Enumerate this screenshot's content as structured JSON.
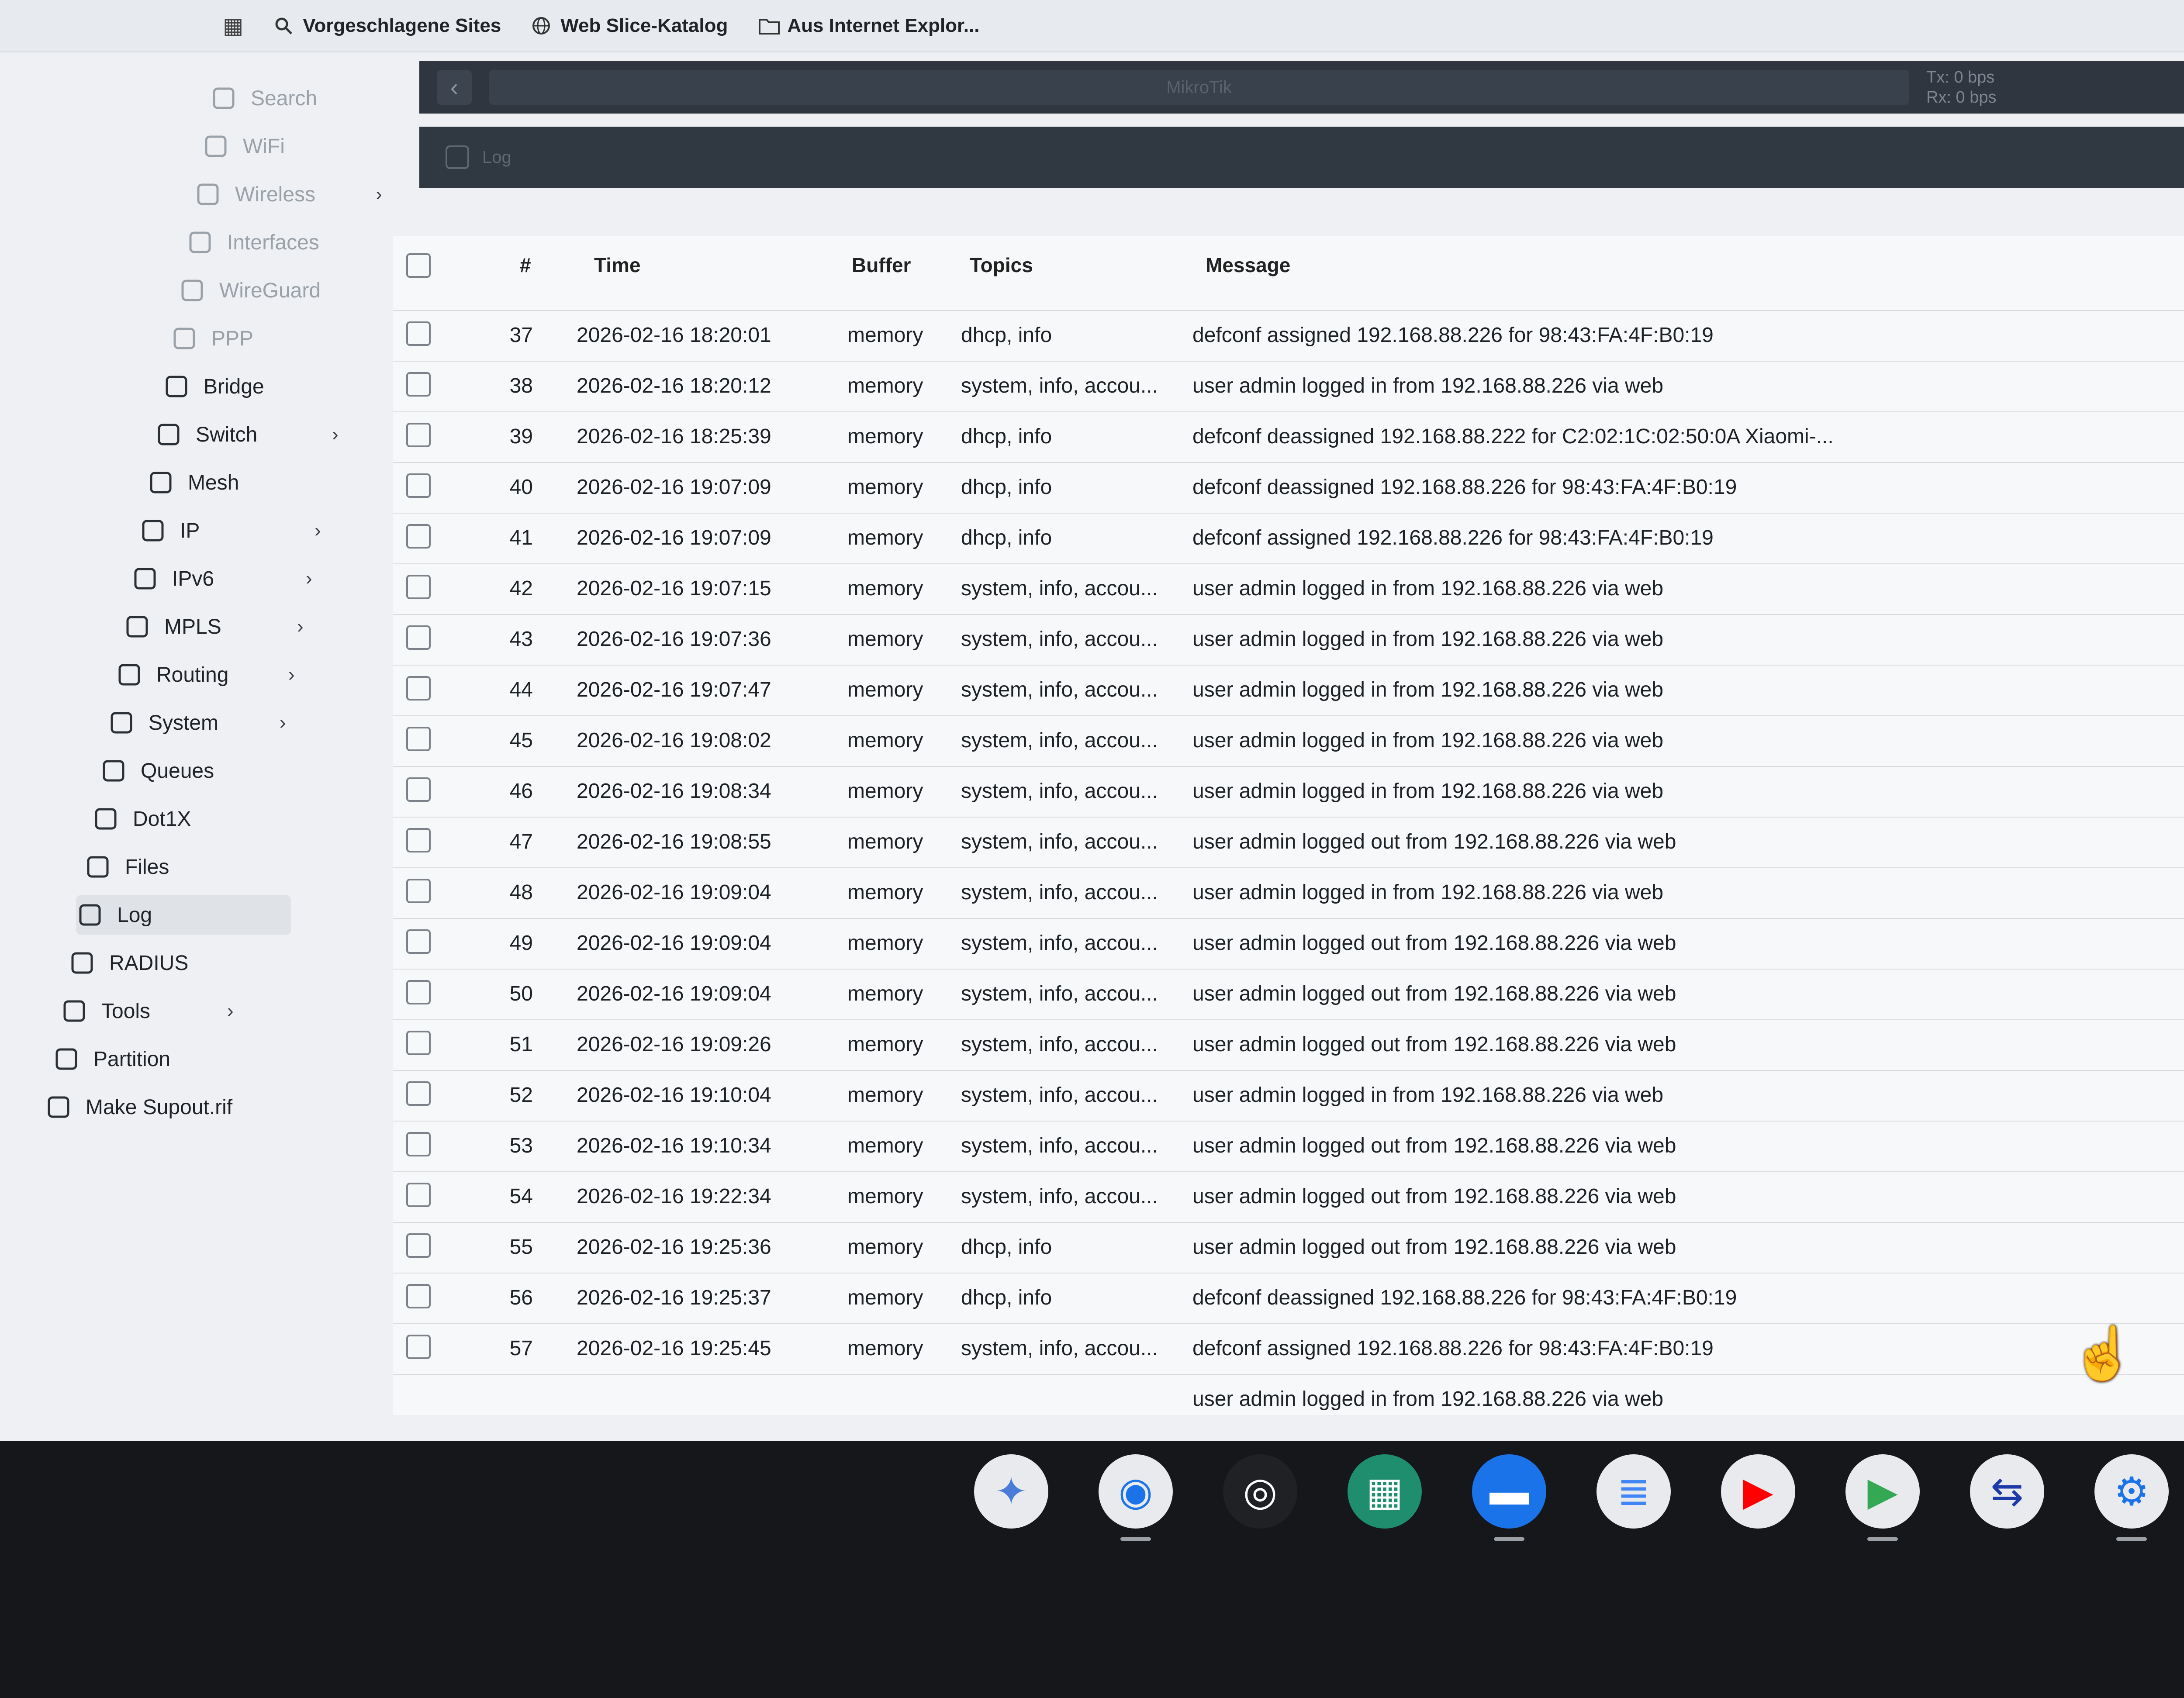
{
  "favorites": {
    "items": [
      {
        "label": "Vorgeschlagene Sites",
        "icon": "search-icon"
      },
      {
        "label": "Web Slice-Katalog",
        "icon": "globe-icon"
      },
      {
        "label": "Aus Internet Explor...",
        "icon": "folder-icon"
      }
    ]
  },
  "toolbar": {
    "identity": "MikroTik",
    "traffic_tx": "Tx: 0 bps",
    "traffic_rx": "Rx: 0 bps",
    "subbar_label": "Log"
  },
  "sidebar": {
    "items": [
      {
        "label": "Search",
        "icon": "search-icon"
      },
      {
        "label": "WiFi",
        "icon": "wifi-icon"
      },
      {
        "label": "Wireless",
        "icon": "antenna-icon",
        "chevron": true
      },
      {
        "label": "Interfaces",
        "icon": "interfaces-icon"
      },
      {
        "label": "WireGuard",
        "icon": "wireguard-icon"
      },
      {
        "label": "PPP",
        "icon": "ppp-icon"
      },
      {
        "label": "Bridge",
        "icon": "bridge-icon"
      },
      {
        "label": "Switch",
        "icon": "switch-icon",
        "chevron": true
      },
      {
        "label": "Mesh",
        "icon": "mesh-icon"
      },
      {
        "label": "IP",
        "icon": "ipv4-icon",
        "chevron": true
      },
      {
        "label": "IPv6",
        "icon": "ipv6-icon",
        "chevron": true
      },
      {
        "label": "MPLS",
        "icon": "mpls-icon",
        "chevron": true
      },
      {
        "label": "Routing",
        "icon": "routing-icon",
        "chevron": true
      },
      {
        "label": "System",
        "icon": "gear-icon",
        "chevron": true
      },
      {
        "label": "Queues",
        "icon": "queues-icon"
      },
      {
        "label": "Dot1X",
        "icon": "dot1x-icon"
      },
      {
        "label": "Files",
        "icon": "folder-icon"
      },
      {
        "label": "Log",
        "icon": "log-icon"
      },
      {
        "label": "RADIUS",
        "icon": "radius-icon"
      },
      {
        "label": "Tools",
        "icon": "tools-icon",
        "chevron": true
      },
      {
        "label": "Partition",
        "icon": "partition-icon"
      },
      {
        "label": "Make Supout.rif",
        "icon": "supout-icon"
      }
    ]
  },
  "table": {
    "headers": {
      "num": "#",
      "time": "Time",
      "buffer": "Buffer",
      "topics": "Topics",
      "message": "Message"
    },
    "rows": [
      {
        "num": "37",
        "time": "2026-02-16 18:20:01",
        "buffer": "memory",
        "topics": "dhcp, info",
        "message": "defconf assigned 192.168.88.226 for 98:43:FA:4F:B0:19"
      },
      {
        "num": "38",
        "time": "2026-02-16 18:20:12",
        "buffer": "memory",
        "topics": "system, info, accou...",
        "message": "user admin logged in from 192.168.88.226 via web"
      },
      {
        "num": "39",
        "time": "2026-02-16 18:25:39",
        "buffer": "memory",
        "topics": "dhcp, info",
        "message": "defconf deassigned 192.168.88.222 for C2:02:1C:02:50:0A Xiaomi-..."
      },
      {
        "num": "40",
        "time": "2026-02-16 19:07:09",
        "buffer": "memory",
        "topics": "dhcp, info",
        "message": "defconf deassigned 192.168.88.226 for 98:43:FA:4F:B0:19"
      },
      {
        "num": "41",
        "time": "2026-02-16 19:07:09",
        "buffer": "memory",
        "topics": "dhcp, info",
        "message": "defconf assigned 192.168.88.226 for 98:43:FA:4F:B0:19"
      },
      {
        "num": "42",
        "time": "2026-02-16 19:07:15",
        "buffer": "memory",
        "topics": "system, info, accou...",
        "message": "user admin logged in from 192.168.88.226 via web"
      },
      {
        "num": "43",
        "time": "2026-02-16 19:07:36",
        "buffer": "memory",
        "topics": "system, info, accou...",
        "message": "user admin logged in from 192.168.88.226 via web"
      },
      {
        "num": "44",
        "time": "2026-02-16 19:07:47",
        "buffer": "memory",
        "topics": "system, info, accou...",
        "message": "user admin logged in from 192.168.88.226 via web"
      },
      {
        "num": "45",
        "time": "2026-02-16 19:08:02",
        "buffer": "memory",
        "topics": "system, info, accou...",
        "message": "user admin logged in from 192.168.88.226 via web"
      },
      {
        "num": "46",
        "time": "2026-02-16 19:08:34",
        "buffer": "memory",
        "topics": "system, info, accou...",
        "message": "user admin logged in from 192.168.88.226 via web"
      },
      {
        "num": "47",
        "time": "2026-02-16 19:08:55",
        "buffer": "memory",
        "topics": "system, info, accou...",
        "message": "user admin logged out from 192.168.88.226 via web"
      },
      {
        "num": "48",
        "time": "2026-02-16 19:09:04",
        "buffer": "memory",
        "topics": "system, info, accou...",
        "message": "user admin logged in from 192.168.88.226 via web"
      },
      {
        "num": "49",
        "time": "2026-02-16 19:09:04",
        "buffer": "memory",
        "topics": "system, info, accou...",
        "message": "user admin logged out from 192.168.88.226 via web"
      },
      {
        "num": "50",
        "time": "2026-02-16 19:09:04",
        "buffer": "memory",
        "topics": "system, info, accou...",
        "message": "user admin logged out from 192.168.88.226 via web"
      },
      {
        "num": "51",
        "time": "2026-02-16 19:09:26",
        "buffer": "memory",
        "topics": "system, info, accou...",
        "message": "user admin logged out from 192.168.88.226 via web"
      },
      {
        "num": "52",
        "time": "2026-02-16 19:10:04",
        "buffer": "memory",
        "topics": "system, info, accou...",
        "message": "user admin logged in from 192.168.88.226 via web"
      },
      {
        "num": "53",
        "time": "2026-02-16 19:10:34",
        "buffer": "memory",
        "topics": "system, info, accou...",
        "message": "user admin logged out from 192.168.88.226 via web"
      },
      {
        "num": "54",
        "time": "2026-02-16 19:22:34",
        "buffer": "memory",
        "topics": "system, info, accou...",
        "message": "user admin logged out from 192.168.88.226 via web"
      },
      {
        "num": "55",
        "time": "2026-02-16 19:25:36",
        "buffer": "memory",
        "topics": "dhcp, info",
        "message": "user admin logged out from 192.168.88.226 via web"
      },
      {
        "num": "56",
        "time": "2026-02-16 19:25:37",
        "buffer": "memory",
        "topics": "dhcp, info",
        "message": "defconf deassigned 192.168.88.226 for 98:43:FA:4F:B0:19"
      },
      {
        "num": "57",
        "time": "2026-02-16 19:25:45",
        "buffer": "memory",
        "topics": "system, info, accou...",
        "message": "defconf assigned 192.168.88.226 for 98:43:FA:4F:B0:19"
      },
      {
        "num": "",
        "time": "",
        "buffer": "",
        "topics": "",
        "message": "user admin logged in from 192.168.88.226 via web"
      }
    ]
  },
  "dock": {
    "apps": [
      {
        "name": "gemini-icon",
        "bg": "#e8eaed",
        "glyph": "✦",
        "color": "#4a7bd9"
      },
      {
        "name": "chrome-icon",
        "bg": "#e8eaed",
        "glyph": "◉",
        "color": "#1a73e8"
      },
      {
        "name": "podcast-icon",
        "bg": "#202124",
        "glyph": "◎",
        "color": "#ffffff"
      },
      {
        "name": "launcher-icon",
        "bg": "#1e8e6e",
        "glyph": "▦",
        "color": "#ffffff"
      },
      {
        "name": "files-icon",
        "bg": "#1a73e8",
        "glyph": "▬",
        "color": "#ffffff"
      },
      {
        "name": "docs-icon",
        "bg": "#e8eaed",
        "glyph": "≣",
        "color": "#4285f4"
      },
      {
        "name": "youtube-icon",
        "bg": "#e8eaed",
        "glyph": "▶",
        "color": "#ff0000"
      },
      {
        "name": "play-store-icon",
        "bg": "#e8eaed",
        "glyph": "▶",
        "color": "#34a853"
      },
      {
        "name": "remote-desktop-icon",
        "bg": "#e8eaed",
        "glyph": "⇆",
        "color": "#1c3aa9"
      },
      {
        "name": "settings-icon",
        "bg": "#e8eaed",
        "glyph": "⚙",
        "color": "#1a73e8"
      }
    ]
  }
}
